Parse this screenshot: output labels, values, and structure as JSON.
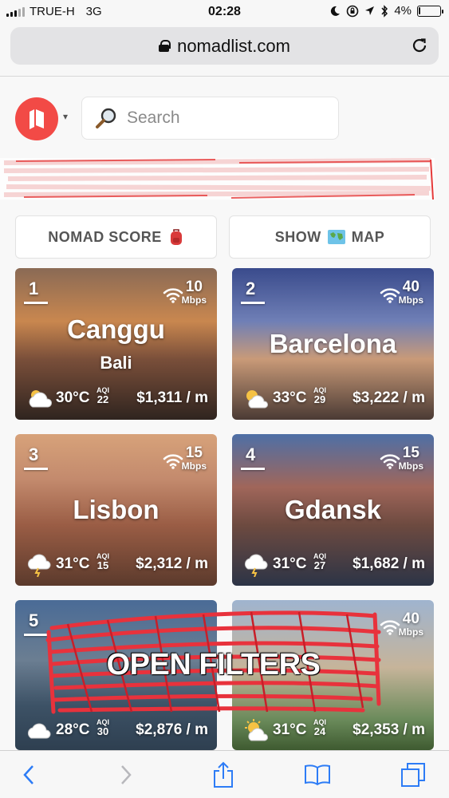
{
  "status_bar": {
    "carrier": "TRUE-H",
    "network": "3G",
    "time": "02:28",
    "battery": "4%",
    "battery_level": 0.04
  },
  "browser": {
    "url": "nomadlist.com"
  },
  "header": {
    "search_placeholder": "Search",
    "brand_color": "#f24a46"
  },
  "buttons": {
    "nomad_score": "NOMAD SCORE",
    "show": "SHOW",
    "map": "MAP"
  },
  "cities": [
    {
      "rank": "1",
      "speed": "10",
      "speed_unit": "Mbps",
      "city": "Canggu",
      "region": "Bali",
      "weather": "partly-cloudy-icon",
      "temp": "30°C",
      "aqi_label": "AQI",
      "aqi": "22",
      "cost": "$1,311 / m"
    },
    {
      "rank": "2",
      "speed": "40",
      "speed_unit": "Mbps",
      "city": "Barcelona",
      "region": "",
      "weather": "sunny-cloud-icon",
      "temp": "33°C",
      "aqi_label": "AQI",
      "aqi": "29",
      "cost": "$3,222 / m"
    },
    {
      "rank": "3",
      "speed": "15",
      "speed_unit": "Mbps",
      "city": "Lisbon",
      "region": "",
      "weather": "storm-cloud-icon",
      "temp": "31°C",
      "aqi_label": "AQI",
      "aqi": "15",
      "cost": "$2,312 / m"
    },
    {
      "rank": "4",
      "speed": "15",
      "speed_unit": "Mbps",
      "city": "Gdansk",
      "region": "",
      "weather": "storm-cloud-icon",
      "temp": "31°C",
      "aqi_label": "AQI",
      "aqi": "27",
      "cost": "$1,682 / m"
    },
    {
      "rank": "5",
      "speed": "",
      "speed_unit": "",
      "city": "",
      "region": "",
      "weather": "cloud-icon",
      "temp": "28°C",
      "aqi_label": "AQI",
      "aqi": "30",
      "cost": "$2,876 / m"
    },
    {
      "rank": "",
      "speed": "40",
      "speed_unit": "Mbps",
      "city": "",
      "region": "",
      "weather": "sun-cloud-icon",
      "temp": "31°C",
      "aqi_label": "AQI",
      "aqi": "24",
      "cost": "$2,353 / m"
    }
  ],
  "overlay": {
    "label": "OPEN FILTERS",
    "color": "#e8323c"
  }
}
